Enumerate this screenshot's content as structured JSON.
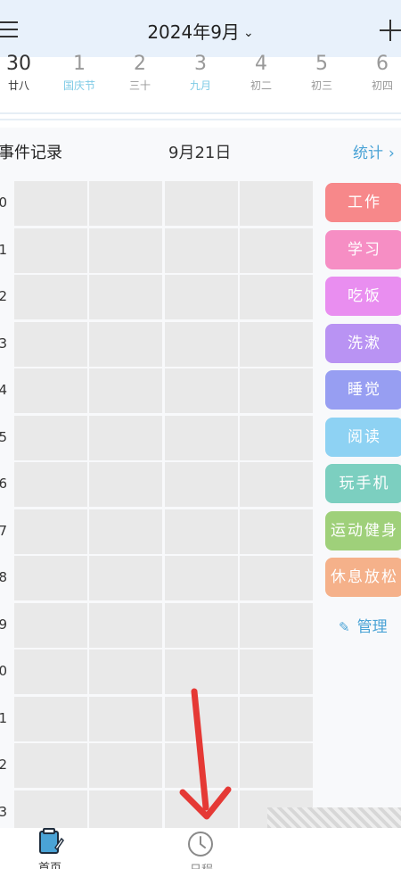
{
  "header": {
    "month_title": "2024年9月",
    "chevron": "⌄"
  },
  "days": [
    {
      "num": "30",
      "sub": "廿八",
      "state": "active"
    },
    {
      "num": "1",
      "sub": "国庆节",
      "state": "holiday"
    },
    {
      "num": "2",
      "sub": "三十",
      "state": "normal"
    },
    {
      "num": "3",
      "sub": "九月",
      "state": "holiday"
    },
    {
      "num": "4",
      "sub": "初二",
      "state": "normal"
    },
    {
      "num": "5",
      "sub": "初三",
      "state": "normal"
    },
    {
      "num": "6",
      "sub": "初四",
      "state": "normal"
    }
  ],
  "section": {
    "title": "事件记录",
    "date": "9月21日",
    "stats_label": "统计",
    "stats_arrow": "›"
  },
  "rows": [
    "0",
    "1",
    "2",
    "3",
    "4",
    "5",
    "6",
    "7",
    "8",
    "9",
    "0",
    "1",
    "2",
    "3"
  ],
  "tags": [
    {
      "label": "工作",
      "color": "#f7888a"
    },
    {
      "label": "学习",
      "color": "#f68ec4"
    },
    {
      "label": "吃饭",
      "color": "#e98ef0"
    },
    {
      "label": "洗漱",
      "color": "#b993f3"
    },
    {
      "label": "睡觉",
      "color": "#979ef2"
    },
    {
      "label": "阅读",
      "color": "#8ed2f3"
    },
    {
      "label": "玩手机",
      "color": "#7ccfc0"
    },
    {
      "label": "运动健身",
      "color": "#9fd07a"
    },
    {
      "label": "休息放松",
      "color": "#f5b18a"
    }
  ],
  "manage_label": "管理",
  "bottom_nav": {
    "home_label": "首页",
    "schedule_label": "日程"
  },
  "annotation_color": "#e53935",
  "icons": {
    "menu": "menu-icon",
    "add": "plus-icon",
    "edit": "pencil-icon",
    "home": "notebook-icon",
    "schedule": "clock-icon"
  }
}
